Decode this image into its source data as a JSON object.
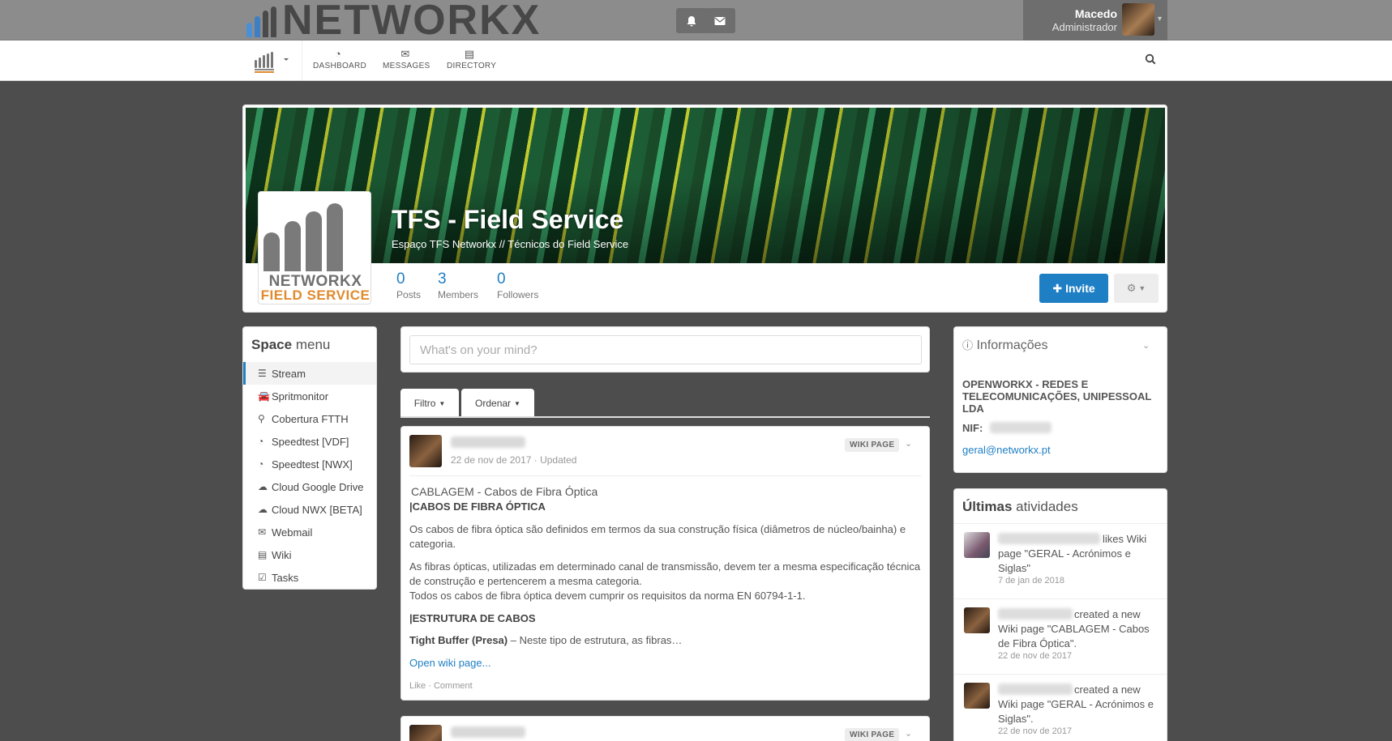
{
  "app": {
    "logo_text": "NETWORKX"
  },
  "topbar": {
    "user_name": "Macedo",
    "user_role": "Administrador",
    "notifications_icon": "bell-icon",
    "messages_icon": "envelope-icon"
  },
  "nav": {
    "items": [
      {
        "label": "DASHBOARD",
        "icon": "dashboard-icon"
      },
      {
        "label": "MESSAGES",
        "icon": "envelope-icon"
      },
      {
        "label": "DIRECTORY",
        "icon": "book-icon"
      }
    ],
    "search_icon": "search-icon"
  },
  "space": {
    "title": "TFS - Field Service",
    "description": "Espaço TFS Networkx // Técnicos do Field Service",
    "logo_line1": "NETWORKX",
    "logo_line2": "FIELD SERVICE",
    "stats": [
      {
        "value": "0",
        "label": "Posts"
      },
      {
        "value": "3",
        "label": "Members"
      },
      {
        "value": "0",
        "label": "Followers"
      }
    ],
    "invite_label": "Invite"
  },
  "space_menu": {
    "title_bold": "Space",
    "title_rest": "menu",
    "items": [
      {
        "label": "Stream",
        "icon": "bars-icon",
        "active": true
      },
      {
        "label": "Spritmonitor",
        "icon": "car-icon"
      },
      {
        "label": "Cobertura FTTH",
        "icon": "map-marker-icon"
      },
      {
        "label": "Speedtest [VDF]",
        "icon": "dashboard-icon"
      },
      {
        "label": "Speedtest [NWX]",
        "icon": "dashboard-icon"
      },
      {
        "label": "Cloud Google Drive",
        "icon": "cloud-icon"
      },
      {
        "label": "Cloud NWX [BETA]",
        "icon": "cloud-icon"
      },
      {
        "label": "Webmail",
        "icon": "envelope-icon"
      },
      {
        "label": "Wiki",
        "icon": "book-icon"
      },
      {
        "label": "Tasks",
        "icon": "check-square-icon"
      }
    ]
  },
  "stream": {
    "post_placeholder": "What's on your mind?",
    "filter_label": "Filtro",
    "sort_label": "Ordenar",
    "posts": [
      {
        "date": "22 de nov de 2017 · Updated",
        "badge": "WIKI PAGE",
        "title": "CABLAGEM - Cabos de Fibra Óptica",
        "heading1": "|CABOS DE FIBRA ÓPTICA",
        "para1": "Os cabos de fibra óptica são definidos em termos da sua construção física (diâmetros de núcleo/bainha) e categoria.",
        "para2": "As fibras ópticas, utilizadas em determinado canal de transmissão, devem ter a mesma especificação técnica de construção e pertencerem a mesma categoria.",
        "para3": "Todos os cabos de fibra óptica devem cumprir os requisitos da norma EN 60794-1-1.",
        "heading2": "|ESTRUTURA DE CABOS",
        "para4_bold": "Tight Buffer (Presa)",
        "para4_rest": " – Neste tipo de estrutura, as fibras…",
        "open_link": "Open wiki page...",
        "like": "Like",
        "comment": "Comment"
      },
      {
        "badge": "WIKI PAGE"
      }
    ]
  },
  "info": {
    "title": "Informações",
    "company": "OPENWORKX - REDES E TELECOMUNICAÇÕES, UNIPESSOAL LDA",
    "nif_label": "NIF:",
    "email": "geral@networkx.pt"
  },
  "activities": {
    "title_bold": "Últimas",
    "title_rest": "atividades",
    "items": [
      {
        "text": "likes Wiki page \"GERAL - Acrónimos e Siglas\"",
        "date": "7 de jan de 2018"
      },
      {
        "text": "created a new Wiki page \"CABLAGEM - Cabos de Fibra Óptica\".",
        "date": "22 de nov de 2017"
      },
      {
        "text": "created a new Wiki page \"GERAL - Acrónimos e Siglas\".",
        "date": "22 de nov de 2017"
      }
    ]
  },
  "colors": {
    "accent": "#1f7fc5",
    "topbar": "#8c8c8c",
    "background": "#4d4d4d"
  }
}
